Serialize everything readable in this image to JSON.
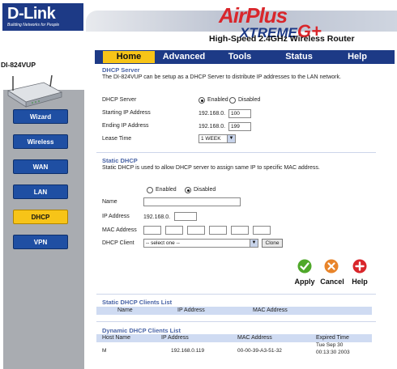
{
  "header": {
    "brand": "D-Link",
    "brand_tagline": "Building Networks for People",
    "product_line_1": "AirPlus",
    "product_line_2": "XTREME",
    "product_line_2_suffix": "G+",
    "tagline": "High-Speed 2.4GHz Wireless Router",
    "model": "DI-824VUP"
  },
  "tabs": [
    {
      "label": "Home",
      "active": true
    },
    {
      "label": "Advanced",
      "active": false
    },
    {
      "label": "Tools",
      "active": false
    },
    {
      "label": "Status",
      "active": false
    },
    {
      "label": "Help",
      "active": false
    }
  ],
  "sidebar": {
    "items": [
      {
        "label": "Wizard",
        "active": false
      },
      {
        "label": "Wireless",
        "active": false
      },
      {
        "label": "WAN",
        "active": false
      },
      {
        "label": "LAN",
        "active": false
      },
      {
        "label": "DHCP",
        "active": true
      },
      {
        "label": "VPN",
        "active": false
      }
    ]
  },
  "dhcp_server": {
    "title": "DHCP Server",
    "description": "The DI-824VUP can be setup as a DHCP Server to distribute IP addresses to the LAN network.",
    "server_label": "DHCP Server",
    "enabled_label": "Enabled",
    "disabled_label": "Disabled",
    "selected": "Enabled",
    "start_ip_label": "Starting IP Address",
    "start_ip_prefix": "192.168.0.",
    "start_ip_value": "100",
    "end_ip_label": "Ending IP Address",
    "end_ip_prefix": "192.168.0.",
    "end_ip_value": "199",
    "lease_label": "Lease Time",
    "lease_value": "1 WEEK"
  },
  "static_dhcp": {
    "title": "Static DHCP",
    "description": "Static DHCP is used to allow DHCP server to assign same IP to specific MAC address.",
    "enabled_label": "Enabled",
    "disabled_label": "Disabled",
    "name_label": "Name",
    "ip_label": "IP Address",
    "ip_prefix": "192.168.0.",
    "mac_label": "MAC Address",
    "client_label": "DHCP Client",
    "client_select": "-- select one --",
    "clone_label": "Clone"
  },
  "actions": {
    "apply": "Apply",
    "cancel": "Cancel",
    "help": "Help"
  },
  "static_list": {
    "title": "Static DHCP Clients List",
    "columns": [
      "Name",
      "IP Address",
      "MAC Address"
    ]
  },
  "dynamic_list": {
    "title": "Dynamic DHCP Clients List",
    "columns": [
      "Host Name",
      "IP Address",
      "MAC Address",
      "Expired Time"
    ],
    "rows": [
      {
        "host": "M",
        "ip": "192.168.0.119",
        "mac": "00-00-39-A3-51-32",
        "expired_1": "Tue Sep 30",
        "expired_2": "00:13:30 2003"
      }
    ]
  },
  "colors": {
    "brand_blue": "#1d3a86",
    "accent_yellow": "#f7c418",
    "section_title": "#4964a6"
  }
}
